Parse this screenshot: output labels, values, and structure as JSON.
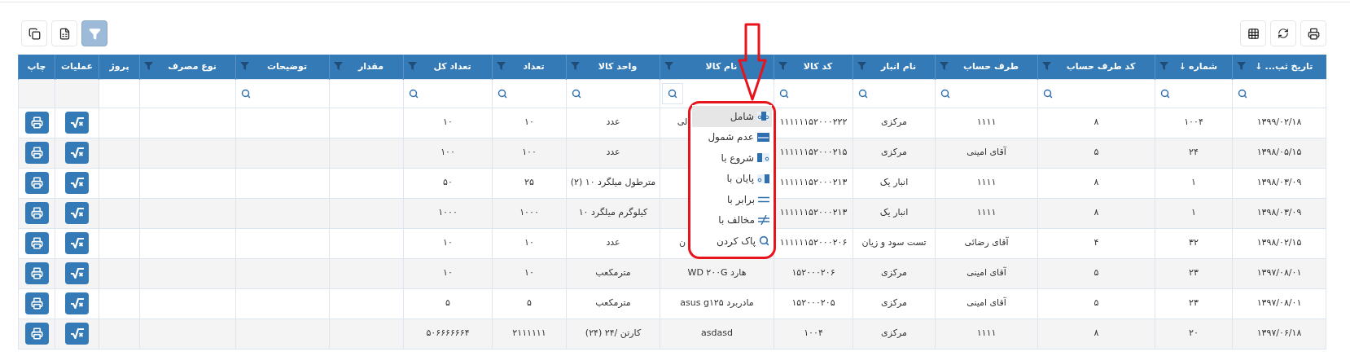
{
  "toolbar_left": [
    {
      "kind": "copy",
      "selected": false
    },
    {
      "kind": "excel",
      "selected": false
    },
    {
      "kind": "filter",
      "selected": true
    }
  ],
  "toolbar_right": [
    {
      "kind": "columns",
      "selected": false
    },
    {
      "kind": "refresh",
      "selected": false
    },
    {
      "kind": "print",
      "selected": false
    }
  ],
  "table": {
    "columns": [
      {
        "label": "تاریخ ثب...",
        "sort_arrow": "↓",
        "funnel": true,
        "search": true,
        "search_menu_open": false,
        "kind": "text"
      },
      {
        "label": "شماره",
        "sort_arrow": "↓",
        "funnel": true,
        "search": true,
        "search_menu_open": false,
        "kind": "text"
      },
      {
        "label": "کد طرف حساب",
        "funnel": true,
        "search": true,
        "search_menu_open": false,
        "kind": "text"
      },
      {
        "label": "طرف حساب",
        "funnel": true,
        "search": true,
        "search_menu_open": false,
        "kind": "text"
      },
      {
        "label": "نام انبار",
        "funnel": true,
        "search": true,
        "search_menu_open": false,
        "kind": "text"
      },
      {
        "label": "کد کالا",
        "funnel": true,
        "search": true,
        "search_menu_open": false,
        "kind": "text"
      },
      {
        "label": "نام کالا",
        "funnel": true,
        "search": true,
        "search_menu_open": true,
        "kind": "text"
      },
      {
        "label": "واحد کالا",
        "funnel": true,
        "search": true,
        "search_menu_open": false,
        "kind": "text"
      },
      {
        "label": "تعداد",
        "funnel": true,
        "search": true,
        "search_menu_open": false,
        "kind": "text"
      },
      {
        "label": "تعداد کل",
        "funnel": true,
        "search": true,
        "search_menu_open": false,
        "kind": "text"
      },
      {
        "label": "مقدار",
        "funnel": true,
        "search": false,
        "kind": "text"
      },
      {
        "label": "توضیحات",
        "funnel": true,
        "search": true,
        "search_menu_open": false,
        "kind": "text"
      },
      {
        "label": "نوع مصرف",
        "funnel": true,
        "search": false,
        "kind": "text"
      },
      {
        "label": "پروژ",
        "funnel": false,
        "search": false,
        "kind": "text"
      },
      {
        "label": "عملیات",
        "funnel": false,
        "search": false,
        "kind": "calc"
      },
      {
        "label": "چاپ",
        "funnel": false,
        "search": false,
        "kind": "print"
      }
    ],
    "rows": [
      {
        "date": "۱۳۹۹/۰۲/۱۸",
        "number": "۱۰۰۴",
        "party_code": "۸",
        "party": "۱۱۱۱",
        "warehouse": "مرکزی",
        "item_code": "۱۱۱۱۱۱۵۲۰۰۰۲۲۲",
        "item_name": "لی",
        "item_name_clipped": true,
        "unit": "عدد",
        "qty": "۱۰",
        "total": "۱۰"
      },
      {
        "date": "۱۳۹۸/۰۵/۱۵",
        "number": "۲۴",
        "party_code": "۵",
        "party": "آقای امینی",
        "warehouse": "مرکزی",
        "item_code": "۱۱۱۱۱۱۵۲۰۰۰۲۱۵",
        "unit": "عدد",
        "qty": "۱۰۰",
        "total": "۱۰۰"
      },
      {
        "date": "۱۳۹۸/۰۳/۰۹",
        "number": "۱",
        "party_code": "۸",
        "party": "۱۱۱۱",
        "warehouse": "انبار یک",
        "item_code": "۱۱۱۱۱۱۵۲۰۰۰۲۱۳",
        "unit": "مترطول میلگرد ۱۰ (۲)",
        "qty": "۲۵",
        "total": "۵۰"
      },
      {
        "date": "۱۳۹۸/۰۳/۰۹",
        "number": "۱",
        "party_code": "۸",
        "party": "۱۱۱۱",
        "warehouse": "انبار یک",
        "item_code": "۱۱۱۱۱۱۵۲۰۰۰۲۱۳",
        "unit": "کیلوگرم میلگرد ۱۰",
        "qty": "۱۰۰۰",
        "total": "۱۰۰۰"
      },
      {
        "date": "۱۳۹۸/۰۲/۱۵",
        "number": "۳۲",
        "party_code": "۴",
        "party": "آقای رضائی",
        "warehouse": "تست سود و زیان",
        "item_code": "۱۱۱۱۱۱۵۲۰۰۰۲۰۶",
        "item_name": "ن",
        "item_name_clipped": true,
        "unit": "عدد",
        "qty": "۱۰",
        "total": "۱۰"
      },
      {
        "date": "۱۳۹۷/۰۸/۰۱",
        "number": "۲۳",
        "party_code": "۵",
        "party": "آقای امینی",
        "warehouse": "مرکزی",
        "item_code": "۱۵۲۰۰۰۲۰۶",
        "item_name": "هارد WD ۲۰۰G",
        "item_name_clipped": false,
        "unit": "مترمکعب",
        "qty": "۱۰",
        "total": "۱۰"
      },
      {
        "date": "۱۳۹۷/۰۸/۰۱",
        "number": "۲۳",
        "party_code": "۵",
        "party": "آقای امینی",
        "warehouse": "مرکزی",
        "item_code": "۱۵۲۰۰۰۲۰۵",
        "item_name": "مادربرد asus g۱۲۵",
        "item_name_clipped": false,
        "unit": "مترمکعب",
        "qty": "۵",
        "total": "۵"
      },
      {
        "date": "۱۳۹۷/۰۶/۱۸",
        "number": "۲۰",
        "party_code": "۸",
        "party": "۱۱۱۱",
        "warehouse": "مرکزی",
        "item_code": "۱۰۰۴",
        "item_name": "asdasd",
        "item_name_clipped": false,
        "unit": "کارتن /۲۴ (۲۴)",
        "qty": "۲۱۱۱۱۱۱",
        "total": "۵۰۶۶۶۶۶۶۴"
      }
    ]
  },
  "filter_menu": {
    "items": [
      {
        "label": "شامل",
        "kind": "contains",
        "selected": true
      },
      {
        "label": "عدم شمول",
        "kind": "not_contains",
        "selected": false
      },
      {
        "label": "شروع با",
        "kind": "starts_with",
        "selected": false
      },
      {
        "label": "پایان با",
        "kind": "ends_with",
        "selected": false
      },
      {
        "label": "برابر با",
        "kind": "equals",
        "selected": false
      },
      {
        "label": "مخالف با",
        "kind": "not_equals",
        "selected": false
      },
      {
        "label": "پاک کردن",
        "kind": "clear",
        "selected": false
      }
    ]
  }
}
